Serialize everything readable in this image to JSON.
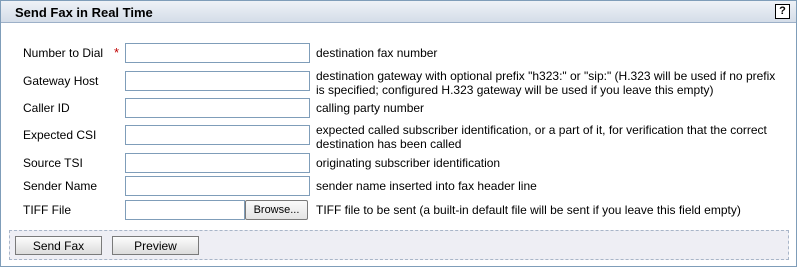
{
  "window": {
    "title": "Send Fax in Real Time",
    "help_label": "?"
  },
  "form": {
    "required_marker": "*",
    "fields": [
      {
        "label": "Number to Dial",
        "value": "",
        "description": "destination fax number"
      },
      {
        "label": "Gateway Host",
        "value": "",
        "description": "destination gateway with optional prefix \"h323:\" or \"sip:\" (H.323 will be used if no prefix is specified; configured H.323 gateway will be used if you leave this empty)"
      },
      {
        "label": "Caller ID",
        "value": "",
        "description": "calling party number"
      },
      {
        "label": "Expected CSI",
        "value": "",
        "description": "expected called subscriber identification, or a part of it, for verification that the correct destination has been called"
      },
      {
        "label": "Source TSI",
        "value": "",
        "description": "originating subscriber identification"
      },
      {
        "label": "Sender Name",
        "value": "",
        "description": "sender name inserted into fax header line"
      },
      {
        "label": "TIFF File",
        "value": "",
        "browse_label": "Browse...",
        "description": "TIFF file to be sent (a built-in default file will be sent if you leave this field empty)"
      }
    ]
  },
  "actions": {
    "send_label": "Send Fax",
    "preview_label": "Preview"
  }
}
